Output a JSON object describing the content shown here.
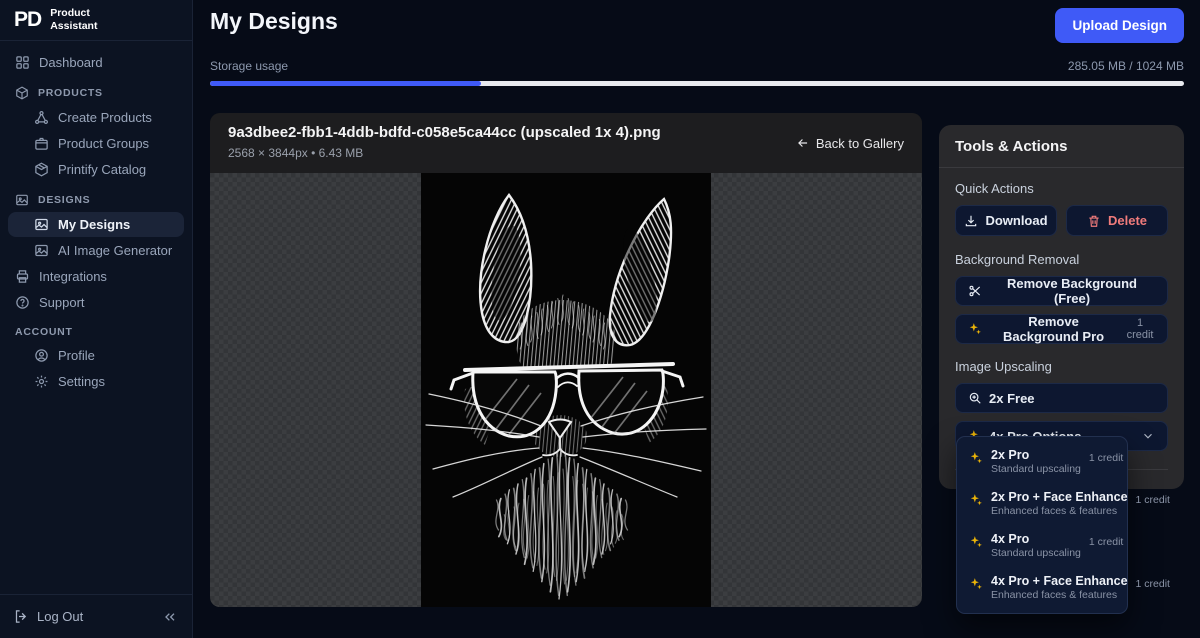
{
  "brand": {
    "logo": "PD",
    "name_line1": "Product",
    "name_line2": "Assistant"
  },
  "sidebar": {
    "items": [
      {
        "type": "item",
        "label": "Dashboard",
        "icon": "grid",
        "indent": 0,
        "active": false
      },
      {
        "type": "section",
        "label": "PRODUCTS",
        "icon": "cube"
      },
      {
        "type": "item",
        "label": "Create Products",
        "icon": "nodes",
        "indent": 1,
        "active": false
      },
      {
        "type": "item",
        "label": "Product Groups",
        "icon": "box",
        "indent": 1,
        "active": false
      },
      {
        "type": "item",
        "label": "Printify Catalog",
        "icon": "catalog",
        "indent": 1,
        "active": false
      },
      {
        "type": "section",
        "label": "DESIGNS",
        "icon": "image"
      },
      {
        "type": "item",
        "label": "My Designs",
        "icon": "image",
        "indent": 1,
        "active": true
      },
      {
        "type": "item",
        "label": "AI Image Generator",
        "icon": "image",
        "indent": 1,
        "active": false
      },
      {
        "type": "item",
        "label": "Integrations",
        "icon": "printer",
        "indent": 0,
        "active": false
      },
      {
        "type": "item",
        "label": "Support",
        "icon": "help",
        "indent": 0,
        "active": false
      },
      {
        "type": "section",
        "label": "ACCOUNT"
      },
      {
        "type": "item",
        "label": "Profile",
        "icon": "user",
        "indent": 1,
        "active": false
      },
      {
        "type": "item",
        "label": "Settings",
        "icon": "gear",
        "indent": 1,
        "active": false
      }
    ],
    "logout_label": "Log Out"
  },
  "header": {
    "title": "My Designs",
    "upload_button": "Upload Design"
  },
  "storage": {
    "label": "Storage usage",
    "usage_text": "285.05 MB / 1024 MB",
    "percent": 27.8
  },
  "viewer": {
    "filename": "9a3dbee2-fbb1-4ddb-bdfd-c058e5ca44cc (upscaled 1x 4).png",
    "meta": "2568 × 3844px • 6.43 MB",
    "back_label": "Back to Gallery"
  },
  "tools": {
    "title": "Tools & Actions",
    "quick": {
      "label": "Quick Actions",
      "download": "Download",
      "delete": "Delete"
    },
    "bg": {
      "label": "Background Removal",
      "free": "Remove Background (Free)",
      "pro": "Remove Background Pro",
      "pro_credit": "1 credit"
    },
    "upscale": {
      "label": "Image Upscaling",
      "free": "2x Free",
      "pro": "4x Pro Options"
    }
  },
  "upscale_menu": {
    "items": [
      {
        "title": "2x Pro",
        "subtitle": "Standard upscaling",
        "credit": "1 credit"
      },
      {
        "title": "2x Pro + Face Enhance",
        "subtitle": "Enhanced faces & features",
        "credit": "1 credit"
      },
      {
        "title": "4x Pro",
        "subtitle": "Standard upscaling",
        "credit": "1 credit"
      },
      {
        "title": "4x Pro + Face Enhance",
        "subtitle": "Enhanced faces & features",
        "credit": "1 credit"
      }
    ]
  },
  "colors": {
    "accent_blue": "#3f5af7",
    "sparkle_yellow": "#eab308",
    "delete_red": "#f07b7b"
  }
}
